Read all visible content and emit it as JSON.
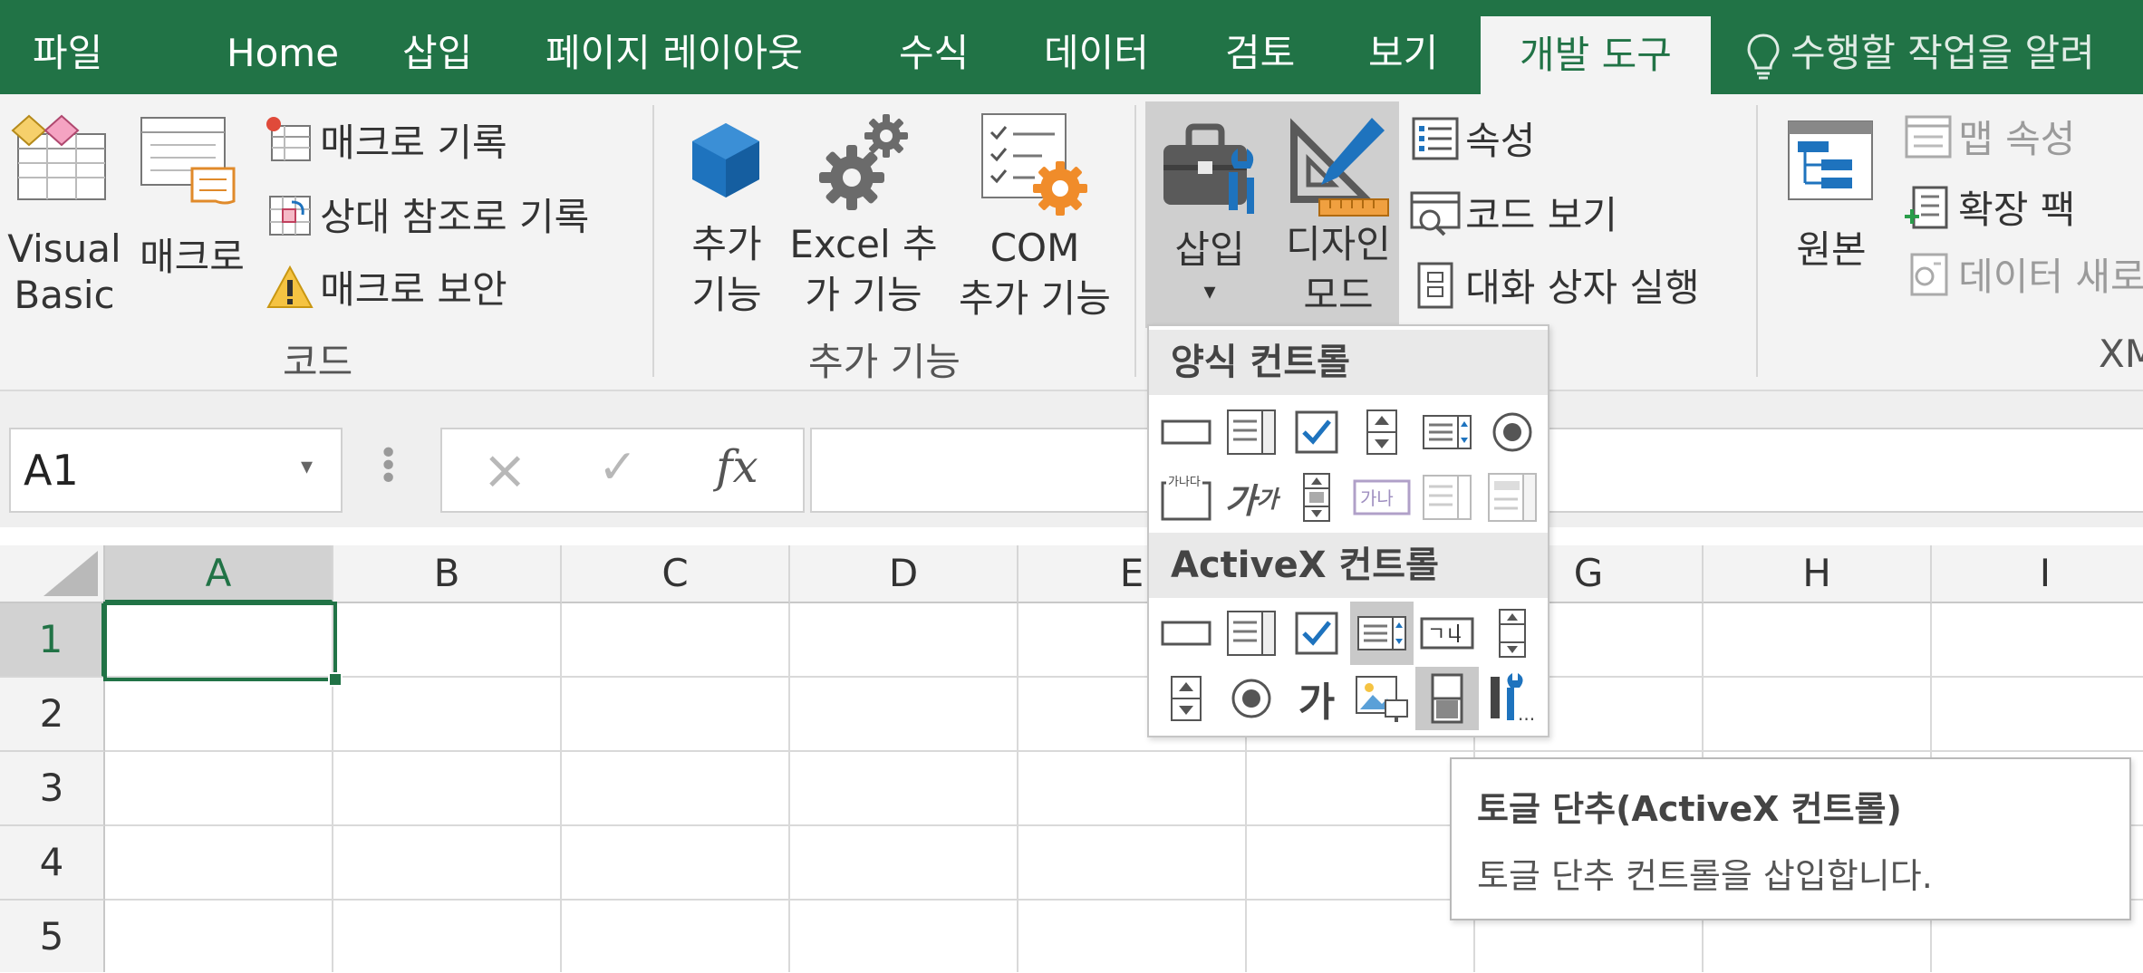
{
  "tabs": {
    "file": "파일",
    "home": "Home",
    "insert": "삽입",
    "page_layout": "페이지 레이아웃",
    "formulas": "수식",
    "data": "데이터",
    "review": "검토",
    "view": "보기",
    "developer": "개발 도구",
    "tell_me": "수행할 작업을 알려"
  },
  "colors": {
    "brand": "#217346",
    "accent_blue": "#1e73be",
    "gear_orange": "#f08c2a"
  },
  "ribbon": {
    "code": {
      "visual_basic": [
        "Visual",
        "Basic"
      ],
      "macros": "매크로",
      "record_macro": "매크로 기록",
      "relative_refs": "상대 참조로 기록",
      "macro_security": "매크로 보안",
      "group_label": "코드"
    },
    "addins": {
      "addins": [
        "추가",
        "기능"
      ],
      "excel_addins": [
        "Excel 추",
        "가 기능"
      ],
      "com_addins": [
        "COM",
        "추가 기능"
      ],
      "group_label": "추가 기능"
    },
    "controls": {
      "insert": "삽입",
      "design_mode": [
        "디자인",
        "모드"
      ],
      "properties": "속성",
      "view_code": "코드 보기",
      "run_dialog": "대화 상자 실행"
    },
    "xml": {
      "source": "원본",
      "map_properties": "맵 속성",
      "expansion_packs": "확장 팩",
      "refresh_data": "데이터 새로",
      "group_label": "XM"
    }
  },
  "formula_bar": {
    "name_box": "A1",
    "cancel_icon": "×",
    "enter_icon": "✓",
    "fx": "fx",
    "formula": ""
  },
  "grid": {
    "columns": [
      "A",
      "B",
      "C",
      "D",
      "E",
      "",
      "G",
      "H",
      "I"
    ],
    "rows": [
      "1",
      "2",
      "3",
      "4",
      "5"
    ],
    "selected_cell": "A1"
  },
  "dropdown": {
    "form_controls_header": "양식 컨트롤",
    "activex_header": "ActiveX 컨트롤",
    "label_glyph": "가",
    "label_glyph_small": "가",
    "groupbox_text": "가나다",
    "button_text": "가나",
    "activex_label_text": "ㄱㄴ",
    "more_text": "..."
  },
  "tooltip": {
    "title": "토글 단추(ActiveX 컨트롤)",
    "description": "토글 단추 컨트롤을 삽입합니다."
  }
}
